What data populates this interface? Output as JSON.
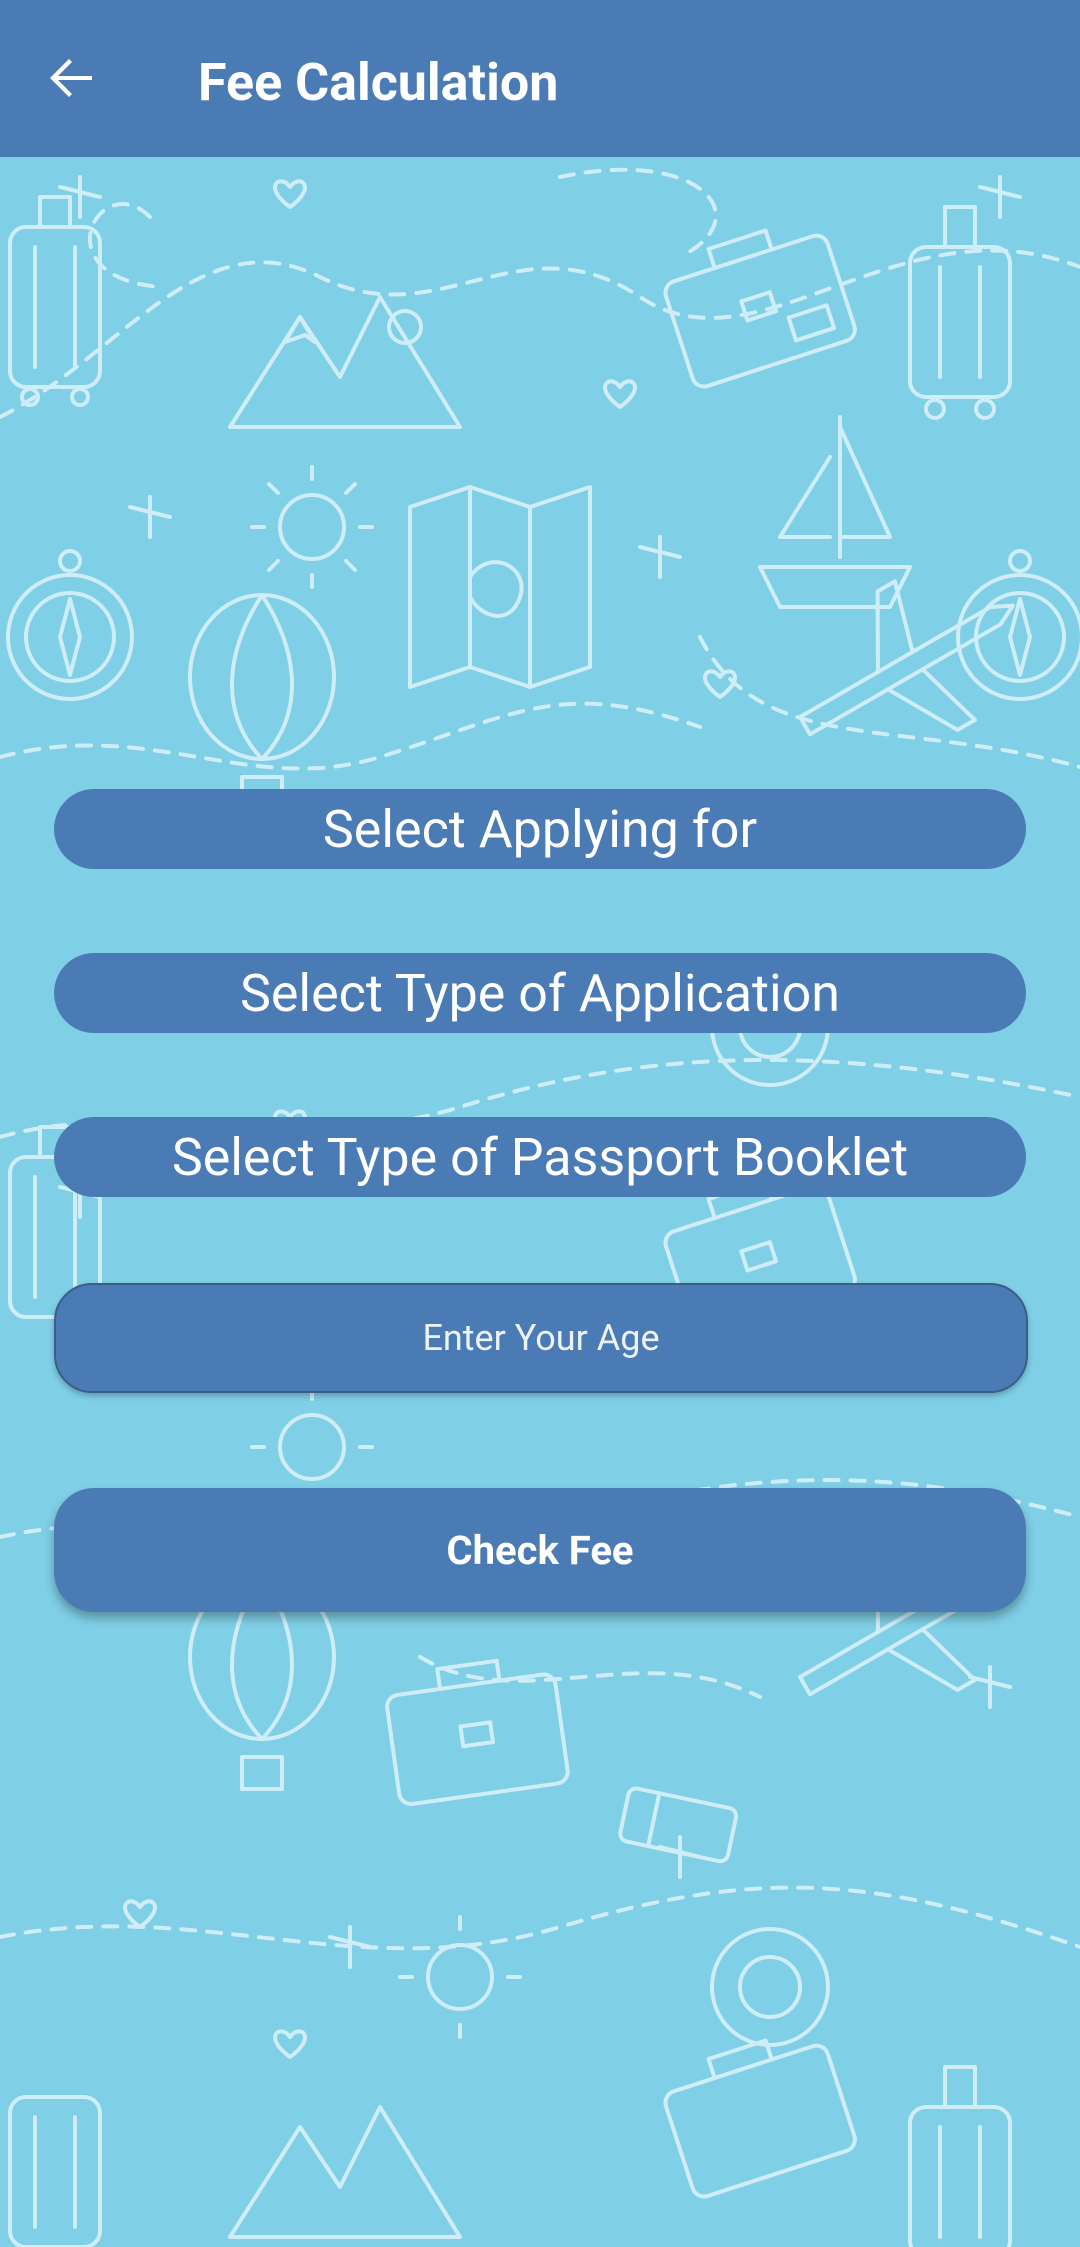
{
  "header": {
    "title": "Fee Calculation",
    "back_icon": "arrow-left-icon",
    "background_color": "#4b7bb5"
  },
  "background": {
    "color": "#7fcfe6",
    "pattern": "travel-doodle-pattern"
  },
  "form": {
    "applying_for_label": "Select Applying for",
    "application_type_label": "Select Type of Application",
    "booklet_type_label": "Select Type of Passport Booklet",
    "age_placeholder": "Enter Your Age",
    "age_value": "",
    "check_fee_label": "Check Fee",
    "button_color": "#4b7bb5"
  }
}
